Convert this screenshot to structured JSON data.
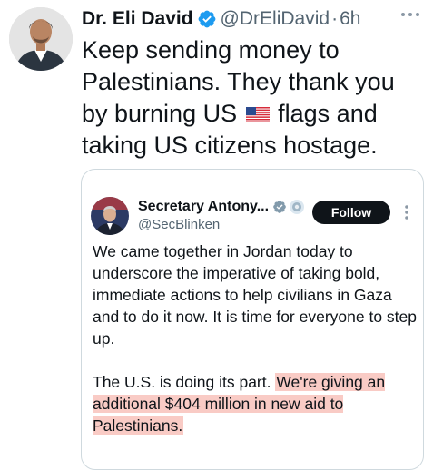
{
  "author": {
    "name": "Dr. Eli David",
    "handle": "@DrEliDavid",
    "separator": "·",
    "time": "6h"
  },
  "tweet": {
    "text_before_flag": "Keep sending money to Palestinians. They thank you by burning US",
    "flag_icon": "us-flag-emoji",
    "text_after_flag": "flags and taking US citizens hostage."
  },
  "quote": {
    "name": "Secretary Antony...",
    "handle": "@SecBlinken",
    "follow_label": "Follow",
    "paragraph1": "We came together in Jordan today to underscore the imperative of taking bold, immediate actions to help civilians in Gaza and to do it now. It is time for everyone to step up.",
    "paragraph2_plain": "The U.S. is doing its part.",
    "paragraph2_highlight": "We're giving an additional $404 million in new aid to Palestinians."
  },
  "colors": {
    "verified_blue": "#1d9bf0",
    "follow_button": "#0f1419",
    "highlight": "#f4a096",
    "secondary_text": "#536471"
  }
}
